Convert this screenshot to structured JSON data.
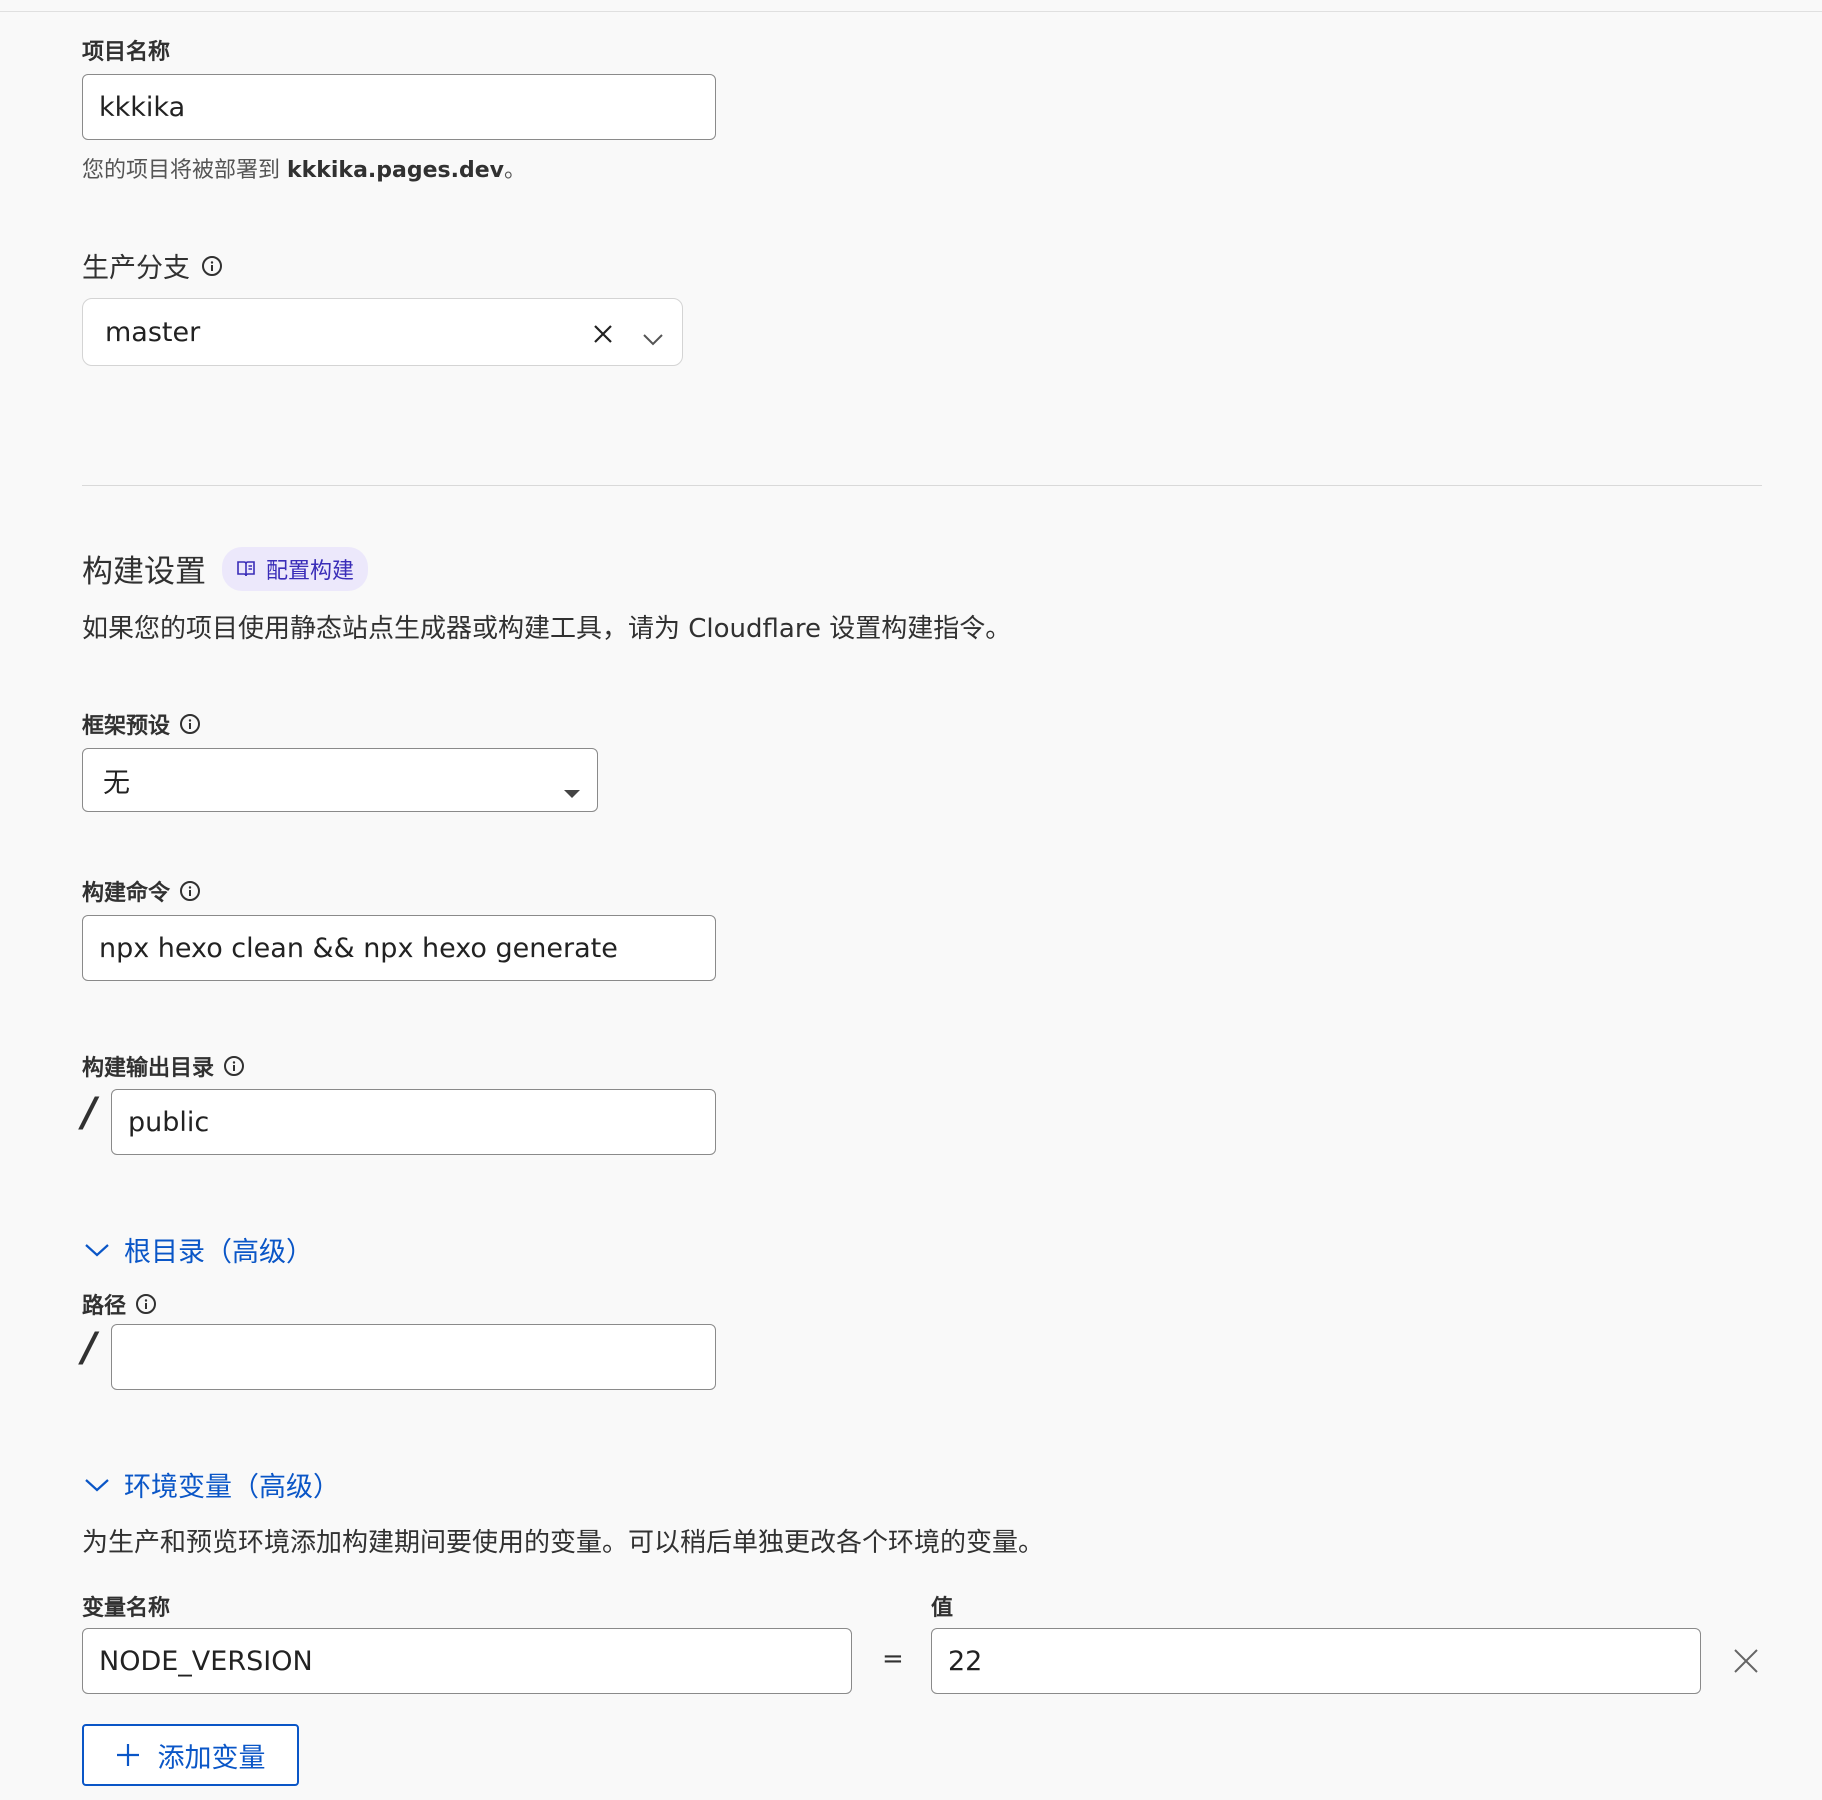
{
  "project": {
    "name_label": "项目名称",
    "name_value": "kkkika",
    "hint_prefix": "您的项目将被部署到 ",
    "hint_domain": "kkkika.pages.dev",
    "hint_suffix": "。"
  },
  "branch": {
    "label": "生产分支",
    "value": "master"
  },
  "build": {
    "title": "构建设置",
    "badge_label": "配置构建",
    "description": "如果您的项目使用静态站点生成器或构建工具，请为 Cloudflare 设置构建指令。",
    "framework_label": "框架预设",
    "framework_value": "无",
    "command_label": "构建命令",
    "command_value": "npx hexo clean && npx hexo generate",
    "output_label": "构建输出目录",
    "output_prefix": "/",
    "output_value": "public"
  },
  "root": {
    "toggle_label": "根目录（高级）",
    "path_label": "路径",
    "path_prefix": "/",
    "path_value": ""
  },
  "env": {
    "toggle_label": "环境变量（高级）",
    "description": "为生产和预览环境添加构建期间要使用的变量。可以稍后单独更改各个环境的变量。",
    "name_header": "变量名称",
    "value_header": "值",
    "equals": "=",
    "rows": [
      {
        "name": "NODE_VERSION",
        "value": "22"
      }
    ],
    "add_label": "添加变量"
  },
  "colors": {
    "link": "#0a56c7",
    "badge_bg": "#ece8fb",
    "badge_text": "#3a2db8",
    "background": "#f9f9f9"
  }
}
